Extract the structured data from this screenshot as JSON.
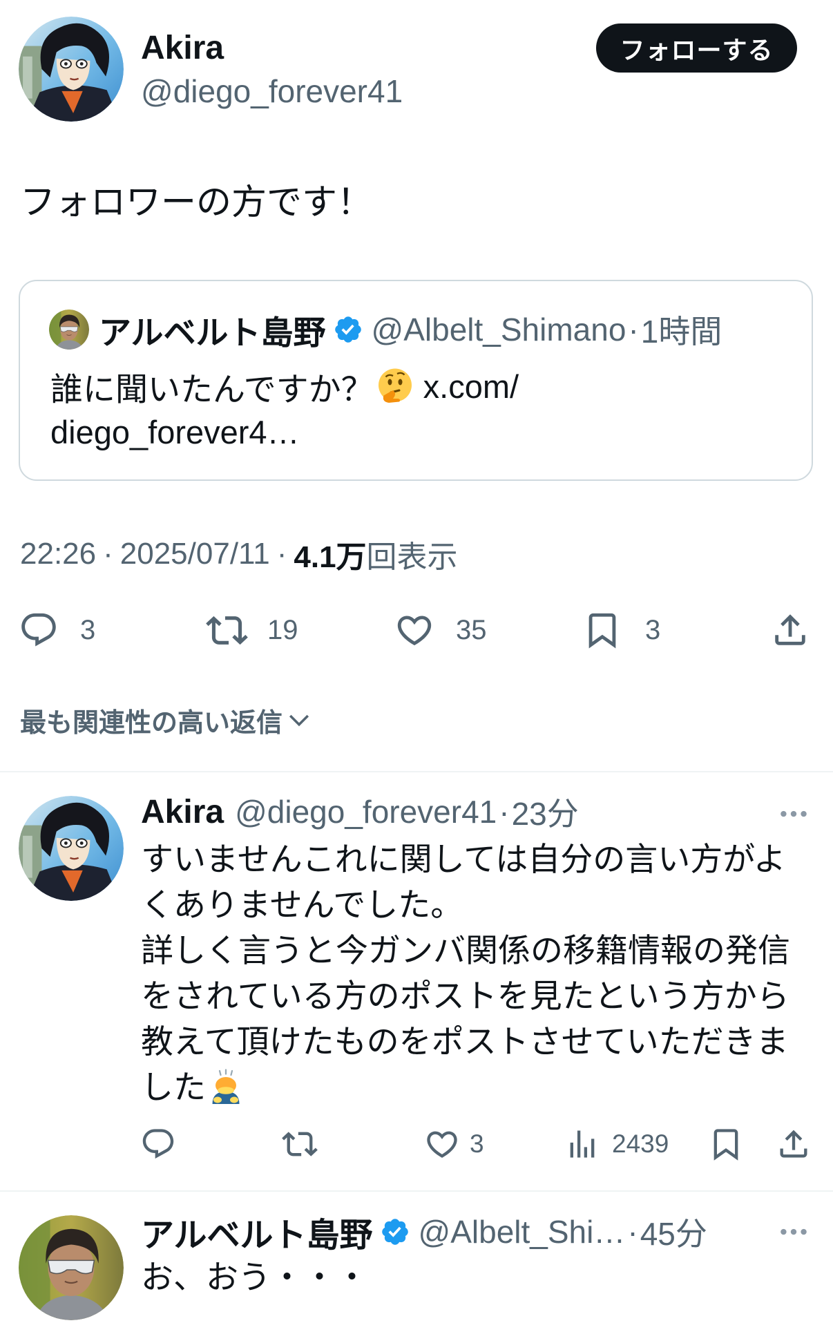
{
  "main_tweet": {
    "author": {
      "name": "Akira",
      "handle": "@diego_forever41",
      "avatar_icon": "anime-character-avatar"
    },
    "follow_button": {
      "label": "フォローする"
    },
    "text": "フォロワーの方です！",
    "quoted_tweet": {
      "author": {
        "name": "アルベルト島野",
        "verified": true,
        "handle": "@Albelt_Shimano",
        "avatar_icon": "man-with-sunglasses-avatar"
      },
      "separator": "·",
      "time": "1時間",
      "text": {
        "line1": "誰に聞いたんですか？",
        "emoji": "thinking-face-emoji",
        "link_part1": "x.com/",
        "link_part2": "diego_forever4…"
      }
    },
    "meta": {
      "time": "22:26",
      "separator": "·",
      "date": "2025/07/11",
      "views_count": "4.1万",
      "views_label": "回表示"
    },
    "stats": {
      "replies": "3",
      "reposts": "19",
      "likes": "35",
      "bookmarks": "3"
    },
    "action_icons": [
      "reply-icon",
      "repost-icon",
      "like-icon",
      "bookmark-icon",
      "share-icon"
    ]
  },
  "replies_sort": {
    "label": "最も関連性の高い返信",
    "icon": "chevron-down-icon"
  },
  "replies": [
    {
      "author": {
        "name": "Akira",
        "handle": "@diego_forever41",
        "verified": false
      },
      "separator": "·",
      "time": "23分",
      "lines": [
        "すいませんこれに関しては自分の言い方がよ",
        "くありませんでした。",
        "詳しく言うと今ガンバ関係の移籍情報の発信",
        "をされている方のポストを見たという方から",
        "教えて頂けたものをポストさせていただきま",
        "した"
      ],
      "trailing_emoji": "bowing-person-emoji",
      "stats": {
        "likes": "3",
        "views": "2439"
      }
    },
    {
      "author": {
        "name": "アルベルト島野",
        "handle": "@Albelt_Shi…",
        "verified": true
      },
      "separator": "·",
      "time": "45分",
      "lines": [
        "お、おう・・・"
      ]
    }
  ],
  "colors": {
    "text": "#0f1419",
    "secondary": "#536471",
    "verified": "#1d9bf0",
    "border": "#cfd9de",
    "divider": "#eff3f4",
    "button_bg": "#0f1419",
    "button_text": "#ffffff"
  }
}
